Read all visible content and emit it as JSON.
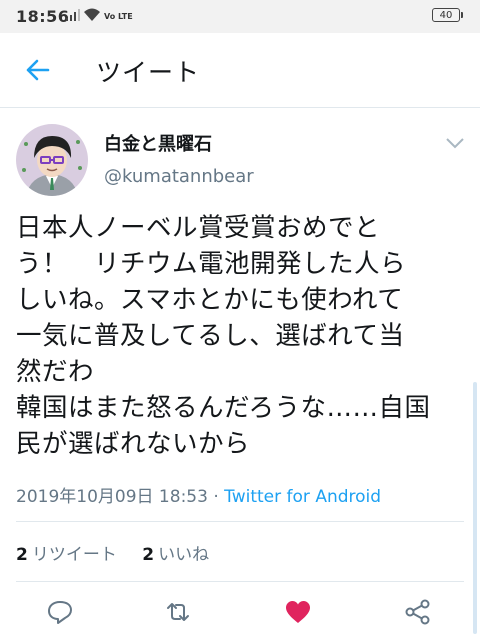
{
  "status_bar": {
    "time": "18:56",
    "network": "Vo LTE",
    "battery": "40"
  },
  "header": {
    "title": "ツイート"
  },
  "tweet": {
    "display_name": "白金と黒曜石",
    "handle": "@kumatannbear",
    "text": "日本人ノーベル賞受賞おめでと\nう！　リチウム電池開発した人ら\nしいね。スマホとかにも使われて\n一気に普及してるし、選ばれて当\n然だわ\n韓国はまた怒るんだろうな……自国\n民が選ばれないから",
    "timestamp": "2019年10月09日 18:53",
    "separator": "·",
    "source": "Twitter for Android",
    "retweets": {
      "count": "2",
      "label": "リツイート"
    },
    "likes": {
      "count": "2",
      "label": "いいね"
    }
  },
  "actions": [
    {
      "icon": "reply-icon"
    },
    {
      "icon": "retweet-icon"
    },
    {
      "icon": "heart-icon",
      "color": "#e0245e"
    },
    {
      "icon": "share-icon"
    }
  ],
  "colors": {
    "accent": "#1da1f2",
    "like": "#e0245e",
    "secondary_text": "#657786"
  }
}
